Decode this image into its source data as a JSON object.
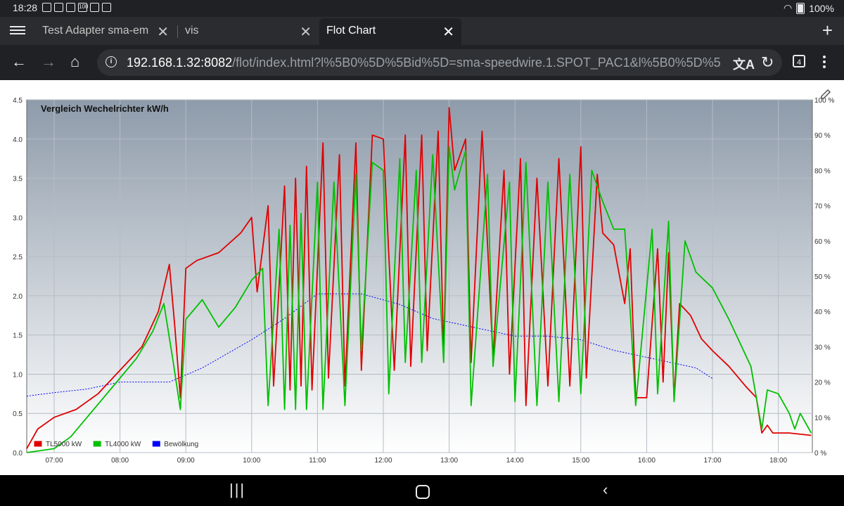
{
  "status": {
    "time": "18:28",
    "battery": "100%",
    "icons": [
      "a",
      "b",
      "c",
      "100",
      "d",
      "e"
    ]
  },
  "tabs": [
    {
      "label": "Test Adapter sma-em",
      "active": false
    },
    {
      "label": "vis",
      "active": false
    },
    {
      "label": "Flot Chart",
      "active": true
    }
  ],
  "toolbar": {
    "url_host": "192.168.1.32:8082",
    "url_rest": "/flot/index.html?l%5B0%5D%5Bid%5D=sma-speedwire.1.SPOT_PAC1&l%5B0%5D%5",
    "tab_count": "4"
  },
  "colors": {
    "red": "#e00000",
    "green": "#00c000",
    "blue": "#0000ff"
  },
  "chart_data": {
    "type": "line",
    "title": "Vergleich Wechelrichter kW/h",
    "x_ticks": [
      "07:00",
      "08:00",
      "09:00",
      "10:00",
      "11:00",
      "12:00",
      "13:00",
      "14:00",
      "15:00",
      "16:00",
      "17:00",
      "18:00"
    ],
    "xlim": [
      "06:35",
      "18:31"
    ],
    "y_left": {
      "ticks": [
        "0.0",
        "0.5",
        "1.0",
        "1.5",
        "2.0",
        "2.5",
        "3.0",
        "3.5",
        "4.0",
        "4.5"
      ],
      "range": [
        0,
        4.5
      ]
    },
    "y_right": {
      "ticks": [
        "0 %",
        "10 %",
        "20 %",
        "30 %",
        "40 %",
        "50 %",
        "60 %",
        "70 %",
        "80 %",
        "90 %",
        "100 %"
      ],
      "range": [
        0,
        100
      ]
    },
    "legend": [
      "TL5000 kW",
      "TL4000 kW",
      "Bewölkung"
    ],
    "legend_position": "bottom-left",
    "series": [
      {
        "name": "TL5000 kW",
        "color": "#e00000",
        "axis": "left",
        "points": [
          [
            "06:35",
            0.05
          ],
          [
            "06:45",
            0.3
          ],
          [
            "07:00",
            0.45
          ],
          [
            "07:20",
            0.55
          ],
          [
            "07:40",
            0.75
          ],
          [
            "08:00",
            1.05
          ],
          [
            "08:20",
            1.35
          ],
          [
            "08:35",
            1.8
          ],
          [
            "08:45",
            2.4
          ],
          [
            "08:50",
            1.6
          ],
          [
            "08:55",
            0.7
          ],
          [
            "09:00",
            2.35
          ],
          [
            "09:10",
            2.45
          ],
          [
            "09:30",
            2.55
          ],
          [
            "09:50",
            2.8
          ],
          [
            "10:00",
            3.0
          ],
          [
            "10:05",
            2.05
          ],
          [
            "10:15",
            3.15
          ],
          [
            "10:20",
            0.85
          ],
          [
            "10:30",
            3.4
          ],
          [
            "10:35",
            0.8
          ],
          [
            "10:40",
            3.5
          ],
          [
            "10:45",
            0.85
          ],
          [
            "10:50",
            3.65
          ],
          [
            "10:55",
            0.8
          ],
          [
            "11:05",
            3.95
          ],
          [
            "11:10",
            0.95
          ],
          [
            "11:20",
            3.8
          ],
          [
            "11:25",
            0.85
          ],
          [
            "11:35",
            3.95
          ],
          [
            "11:40",
            1.05
          ],
          [
            "11:50",
            4.05
          ],
          [
            "12:00",
            4.0
          ],
          [
            "12:10",
            1.05
          ],
          [
            "12:20",
            4.05
          ],
          [
            "12:25",
            1.1
          ],
          [
            "12:35",
            4.05
          ],
          [
            "12:40",
            1.3
          ],
          [
            "12:50",
            4.1
          ],
          [
            "12:55",
            1.25
          ],
          [
            "13:00",
            4.4
          ],
          [
            "13:05",
            3.6
          ],
          [
            "13:15",
            4.0
          ],
          [
            "13:20",
            1.15
          ],
          [
            "13:30",
            4.1
          ],
          [
            "13:40",
            1.2
          ],
          [
            "13:50",
            3.6
          ],
          [
            "13:55",
            1.0
          ],
          [
            "14:05",
            3.75
          ],
          [
            "14:10",
            0.6
          ],
          [
            "14:20",
            3.5
          ],
          [
            "14:30",
            0.85
          ],
          [
            "14:40",
            3.75
          ],
          [
            "14:50",
            0.85
          ],
          [
            "15:00",
            3.9
          ],
          [
            "15:05",
            0.95
          ],
          [
            "15:15",
            3.55
          ],
          [
            "15:20",
            2.8
          ],
          [
            "15:30",
            2.65
          ],
          [
            "15:40",
            1.9
          ],
          [
            "15:45",
            2.6
          ],
          [
            "15:50",
            0.7
          ],
          [
            "16:00",
            0.7
          ],
          [
            "16:10",
            2.6
          ],
          [
            "16:15",
            0.9
          ],
          [
            "16:20",
            2.55
          ],
          [
            "16:25",
            0.7
          ],
          [
            "16:30",
            1.9
          ],
          [
            "16:40",
            1.75
          ],
          [
            "16:50",
            1.45
          ],
          [
            "17:00",
            1.3
          ],
          [
            "17:15",
            1.1
          ],
          [
            "17:30",
            0.85
          ],
          [
            "17:40",
            0.7
          ],
          [
            "17:45",
            0.25
          ],
          [
            "17:50",
            0.35
          ],
          [
            "17:55",
            0.25
          ],
          [
            "18:10",
            0.25
          ],
          [
            "18:30",
            0.22
          ]
        ]
      },
      {
        "name": "TL4000 kW",
        "color": "#00c000",
        "axis": "left",
        "points": [
          [
            "06:35",
            0.0
          ],
          [
            "07:00",
            0.05
          ],
          [
            "07:15",
            0.2
          ],
          [
            "07:30",
            0.45
          ],
          [
            "07:45",
            0.7
          ],
          [
            "08:00",
            0.95
          ],
          [
            "08:15",
            1.2
          ],
          [
            "08:30",
            1.55
          ],
          [
            "08:40",
            1.9
          ],
          [
            "08:48",
            1.2
          ],
          [
            "08:55",
            0.55
          ],
          [
            "09:00",
            1.7
          ],
          [
            "09:15",
            1.95
          ],
          [
            "09:30",
            1.6
          ],
          [
            "09:45",
            1.85
          ],
          [
            "10:00",
            2.2
          ],
          [
            "10:10",
            2.35
          ],
          [
            "10:15",
            0.6
          ],
          [
            "10:25",
            2.85
          ],
          [
            "10:30",
            0.55
          ],
          [
            "10:35",
            2.9
          ],
          [
            "10:40",
            0.55
          ],
          [
            "10:45",
            3.05
          ],
          [
            "10:50",
            0.55
          ],
          [
            "11:00",
            3.45
          ],
          [
            "11:05",
            0.55
          ],
          [
            "11:15",
            3.45
          ],
          [
            "11:25",
            0.6
          ],
          [
            "11:35",
            3.55
          ],
          [
            "11:40",
            1.3
          ],
          [
            "11:50",
            3.7
          ],
          [
            "12:00",
            3.6
          ],
          [
            "12:05",
            0.75
          ],
          [
            "12:15",
            3.75
          ],
          [
            "12:20",
            1.15
          ],
          [
            "12:30",
            3.6
          ],
          [
            "12:35",
            1.15
          ],
          [
            "12:45",
            3.8
          ],
          [
            "12:55",
            1.15
          ],
          [
            "13:00",
            3.9
          ],
          [
            "13:05",
            3.35
          ],
          [
            "13:15",
            3.85
          ],
          [
            "13:20",
            0.6
          ],
          [
            "13:35",
            3.55
          ],
          [
            "13:40",
            1.1
          ],
          [
            "13:55",
            3.45
          ],
          [
            "14:00",
            0.65
          ],
          [
            "14:10",
            3.7
          ],
          [
            "14:20",
            0.6
          ],
          [
            "14:30",
            3.45
          ],
          [
            "14:40",
            0.65
          ],
          [
            "14:50",
            3.55
          ],
          [
            "15:00",
            0.75
          ],
          [
            "15:10",
            3.6
          ],
          [
            "15:20",
            3.2
          ],
          [
            "15:30",
            2.85
          ],
          [
            "15:40",
            2.85
          ],
          [
            "15:45",
            1.8
          ],
          [
            "15:50",
            0.6
          ],
          [
            "16:05",
            2.85
          ],
          [
            "16:10",
            0.75
          ],
          [
            "16:20",
            2.95
          ],
          [
            "16:25",
            0.65
          ],
          [
            "16:35",
            2.7
          ],
          [
            "16:45",
            2.3
          ],
          [
            "17:00",
            2.1
          ],
          [
            "17:15",
            1.7
          ],
          [
            "17:25",
            1.4
          ],
          [
            "17:35",
            1.1
          ],
          [
            "17:45",
            0.3
          ],
          [
            "17:50",
            0.8
          ],
          [
            "18:00",
            0.75
          ],
          [
            "18:10",
            0.5
          ],
          [
            "18:15",
            0.3
          ],
          [
            "18:20",
            0.5
          ],
          [
            "18:30",
            0.25
          ]
        ]
      },
      {
        "name": "Bewölkung",
        "color": "#0000ff",
        "axis": "right",
        "points": [
          [
            "06:35",
            16
          ],
          [
            "07:00",
            17
          ],
          [
            "07:30",
            18
          ],
          [
            "08:00",
            20
          ],
          [
            "08:45",
            20
          ],
          [
            "09:15",
            24
          ],
          [
            "10:00",
            32
          ],
          [
            "10:30",
            38
          ],
          [
            "11:00",
            45
          ],
          [
            "11:40",
            45
          ],
          [
            "12:15",
            42
          ],
          [
            "12:45",
            38
          ],
          [
            "13:15",
            36
          ],
          [
            "14:00",
            33
          ],
          [
            "14:30",
            33
          ],
          [
            "15:00",
            32
          ],
          [
            "15:30",
            29
          ],
          [
            "16:15",
            26
          ],
          [
            "16:45",
            24
          ],
          [
            "17:00",
            21
          ]
        ]
      }
    ]
  }
}
